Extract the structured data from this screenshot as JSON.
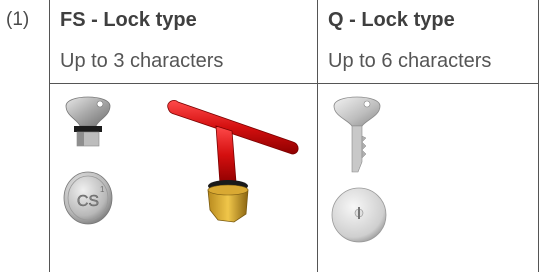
{
  "row_label": "(1)",
  "columns": [
    {
      "title": "FS - Lock type",
      "subtitle": "Up to 3 characters",
      "coin_text": "CS"
    },
    {
      "title": "Q - Lock type",
      "subtitle": "Up to 6 characters"
    }
  ]
}
